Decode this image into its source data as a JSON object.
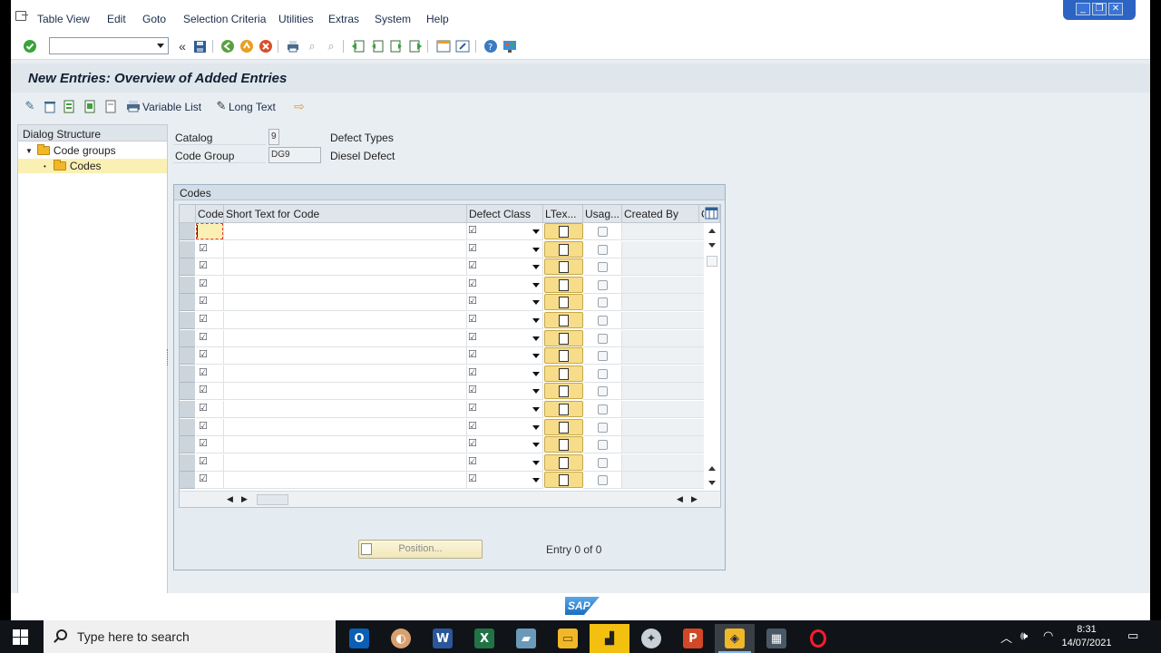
{
  "menubar": {
    "items": [
      "Table View",
      "Edit",
      "Goto",
      "Selection Criteria",
      "Utilities",
      "Extras",
      "System",
      "Help"
    ],
    "window_buttons": [
      "minimize",
      "restore",
      "close"
    ]
  },
  "toolbar": {
    "command_field_value": "",
    "icons": [
      "enter-icon",
      "back-double-icon",
      "save-icon",
      "back-icon",
      "exit-icon",
      "cancel-icon",
      "print-icon",
      "find-icon",
      "find-next-icon",
      "first-page-icon",
      "previous-page-icon",
      "next-page-icon",
      "last-page-icon",
      "create-session-icon",
      "shortcut-icon",
      "help-icon",
      "customize-layout-icon"
    ]
  },
  "title": "New Entries: Overview of Added Entries",
  "app_toolbar": {
    "variable_list": "Variable List",
    "long_text": "Long Text"
  },
  "dialog_structure": {
    "header": "Dialog Structure",
    "nodes": [
      "Code groups",
      "Codes"
    ]
  },
  "header_fields": {
    "catalog_label": "Catalog",
    "catalog_value": "9",
    "catalog_text": "Defect Types",
    "code_group_label": "Code Group",
    "code_group_value": "DG9",
    "code_group_text": "Diesel Defect"
  },
  "codes": {
    "group_title": "Codes",
    "columns": [
      "Code",
      "Short Text for Code",
      "Defect Class",
      "LTex...",
      "Usag...",
      "Created By",
      "C"
    ],
    "row_count": 15
  },
  "position_button": "Position...",
  "entry_text": "Entry 0 of 0",
  "sap_logo": "SAP",
  "taskbar": {
    "search_placeholder": "Type here to search",
    "time": "8:31",
    "date": "14/07/2021"
  },
  "colors": {
    "sap_background": "#e9eef2",
    "title_bar": "#dfe6ec",
    "longtext_button": "#f7dd8a",
    "taskbar": "#101418"
  }
}
